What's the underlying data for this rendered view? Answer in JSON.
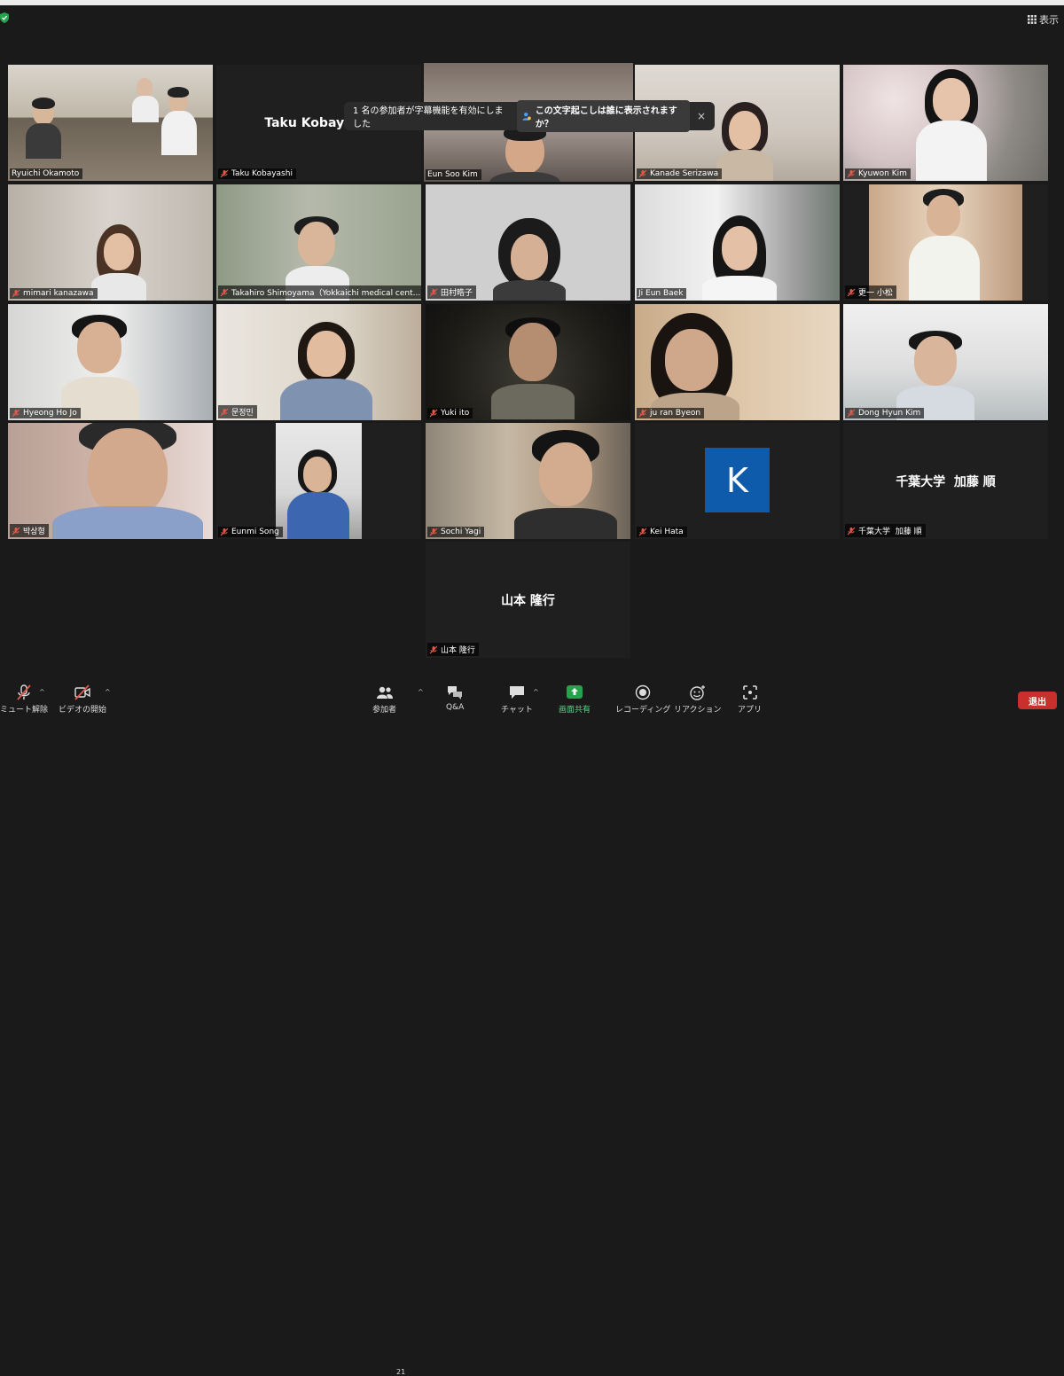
{
  "window": {
    "view_label": "表示"
  },
  "notification": {
    "message": "1 名の参加者が字幕機能を有効にしました",
    "action": "この文字起こしは誰に表示されますか？",
    "close": "×"
  },
  "participants": [
    {
      "name": "Ryuichi Okamoto",
      "muted": false,
      "video": true
    },
    {
      "name": "Taku Kobayashi",
      "muted": true,
      "video": false,
      "display": "Taku Kobayashi"
    },
    {
      "name": "Eun Soo Kim",
      "muted": false,
      "video": true,
      "active": true
    },
    {
      "name": "Kanade Serizawa",
      "muted": true,
      "video": true
    },
    {
      "name": "Kyuwon Kim",
      "muted": true,
      "video": true
    },
    {
      "name": "mimari kanazawa",
      "muted": true,
      "video": true
    },
    {
      "name": "Takahiro Shimoyama（Yokkaichi medical cent...",
      "muted": true,
      "video": true
    },
    {
      "name": "田村晧子",
      "muted": true,
      "video": true
    },
    {
      "name": "Ji Eun Baek",
      "muted": false,
      "video": true
    },
    {
      "name": "更一 小松",
      "muted": true,
      "video": true
    },
    {
      "name": "Hyeong Ho Jo",
      "muted": true,
      "video": true
    },
    {
      "name": "문정민",
      "muted": true,
      "video": true
    },
    {
      "name": "Yuki ito",
      "muted": true,
      "video": true
    },
    {
      "name": "ju ran Byeon",
      "muted": true,
      "video": true
    },
    {
      "name": "Dong Hyun Kim",
      "muted": true,
      "video": true
    },
    {
      "name": "박상형",
      "muted": true,
      "video": true
    },
    {
      "name": "Eunmi Song",
      "muted": true,
      "video": true
    },
    {
      "name": "Sochi Yagi",
      "muted": true,
      "video": true
    },
    {
      "name": "Kei Hata",
      "muted": true,
      "video": false,
      "avatar_letter": "K"
    },
    {
      "name": "千葉大学  加藤 順",
      "muted": true,
      "video": false,
      "display": "千葉大学  加藤 順"
    },
    {
      "name": "山本 隆行",
      "muted": true,
      "video": false,
      "display": "山本 隆行"
    }
  ],
  "toolbar": {
    "unmute": "ミュート解除",
    "start_video": "ビデオの開始",
    "participants": "参加者",
    "participants_count": "21",
    "qa": "Q&A",
    "chat": "チャット",
    "share_screen": "画面共有",
    "recording": "レコーディング",
    "reactions": "リアクション",
    "apps": "アプリ",
    "leave": "退出"
  },
  "colors": {
    "active_speaker": "#c7e26a",
    "share_green": "#23a34e",
    "leave_red": "#c9302c",
    "avatar_blue": "#0e5bab"
  }
}
